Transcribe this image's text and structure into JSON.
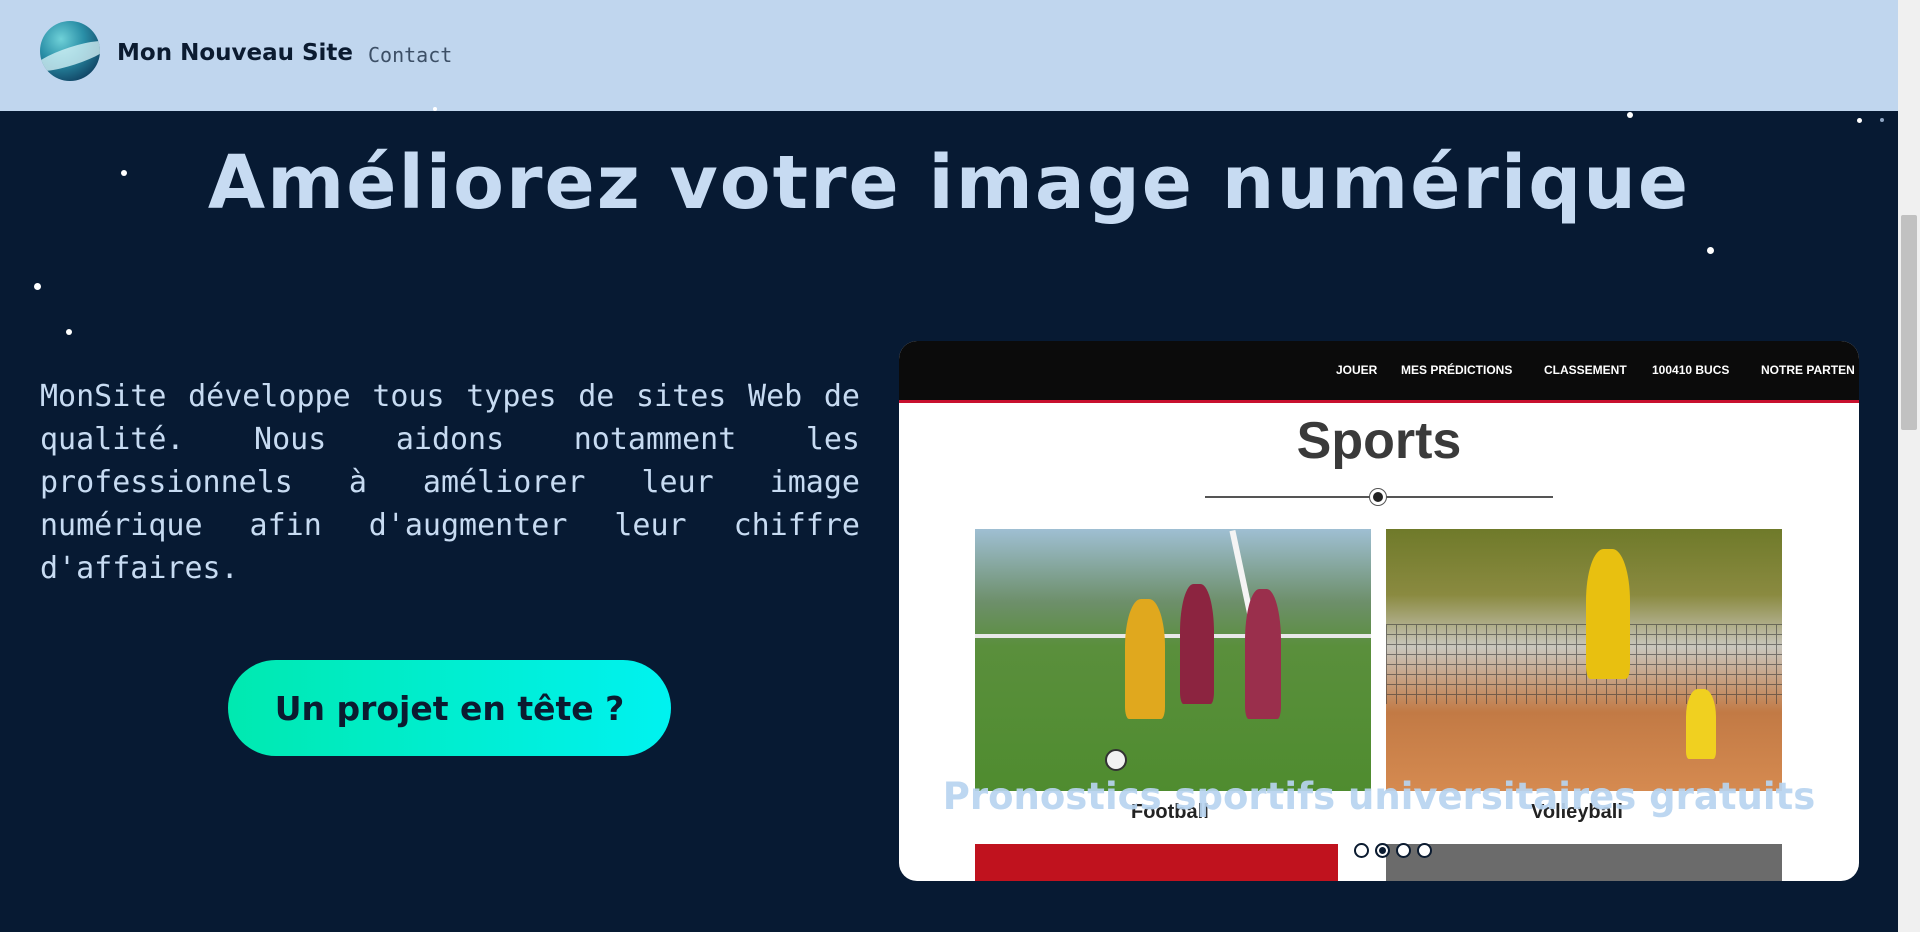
{
  "header": {
    "brand": "Mon Nouveau Site",
    "nav": {
      "contact": "Contact"
    },
    "logo_icon": "globe-logo-icon"
  },
  "hero": {
    "title": "Améliorez votre image numérique",
    "description": "MonSite développe tous types de sites Web de qualité. Nous aidons notamment les professionnels à améliorer leur image numérique afin d'augmenter leur chiffre d'affaires.",
    "cta_label": "Un projet en tête ?"
  },
  "carousel": {
    "nav_items": [
      "JOUER",
      "MES PRÉDICTIONS",
      "CLASSEMENT",
      "100410 BUCS",
      "NOTRE PARTEN"
    ],
    "heading": "Sports",
    "cards": [
      {
        "label": "Football"
      },
      {
        "label": "Volleyball"
      }
    ],
    "overlay_caption": "Pronostics sportifs universitaires gratuits",
    "slide_count": 4,
    "active_slide": 2
  },
  "colors": {
    "background": "#071a33",
    "header": "#c0d6ee",
    "title": "#c7dbf2",
    "cta_gradient_start": "#00e9b0",
    "cta_gradient_end": "#00f2f0"
  }
}
